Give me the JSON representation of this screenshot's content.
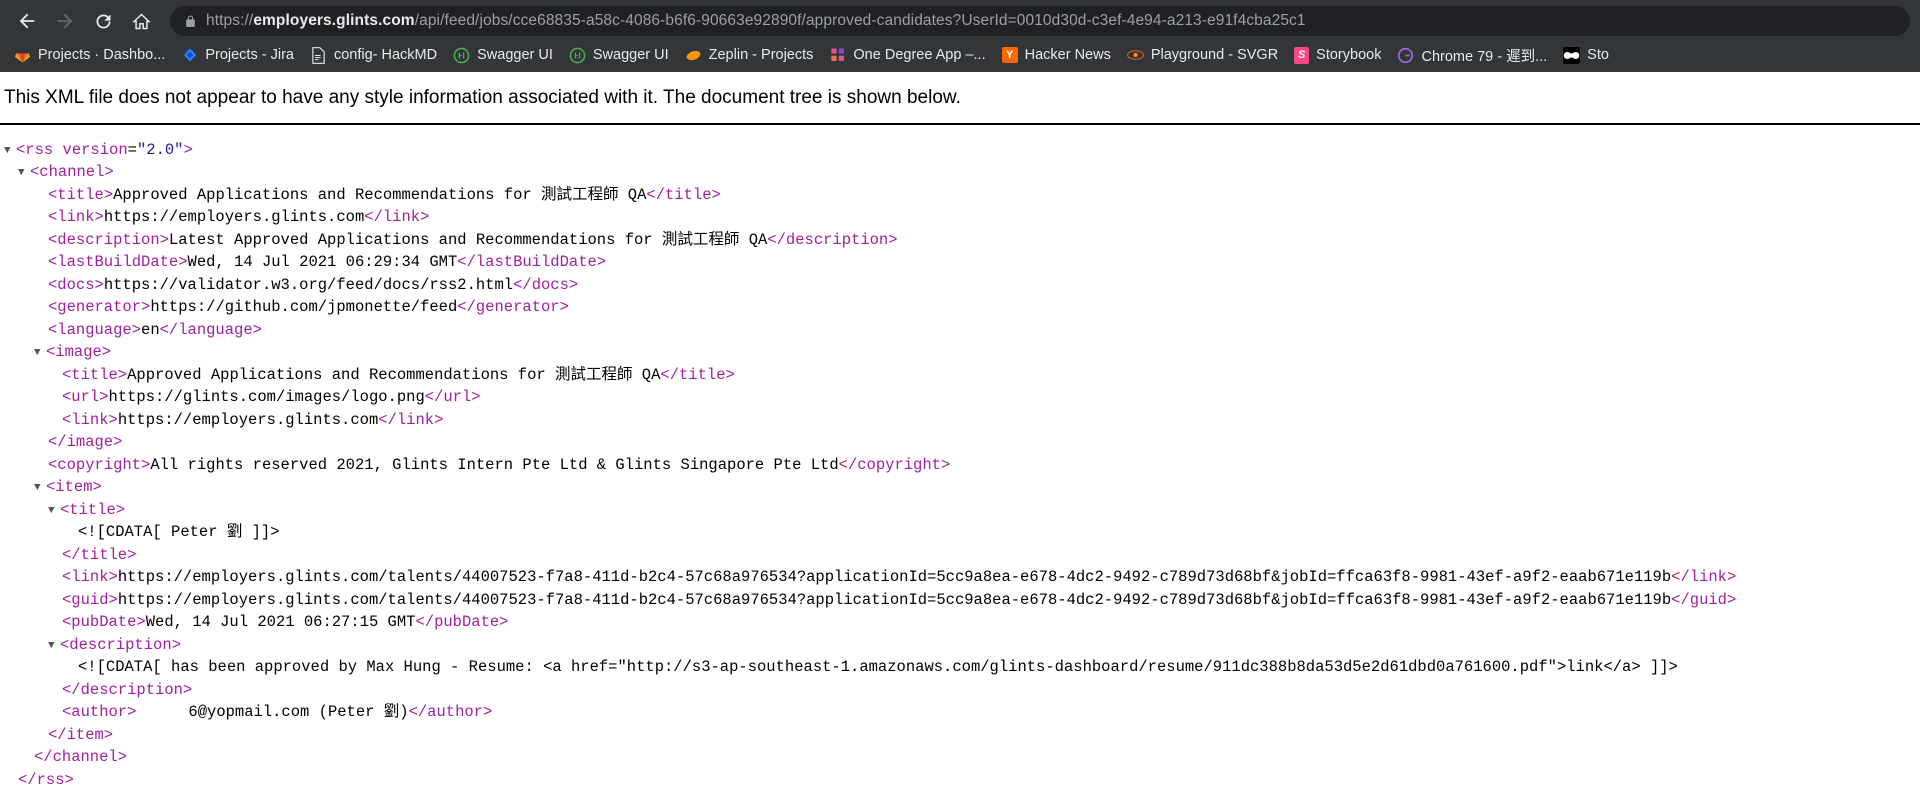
{
  "browser": {
    "nav": {
      "back_label": "Back",
      "forward_label": "Forward",
      "reload_label": "Reload",
      "home_label": "Home"
    },
    "omnibox": {
      "lock_icon": "lock-icon",
      "scheme": "https://",
      "host": "employers.glints.com",
      "path": "/api/feed/jobs/cce68835-a58c-4086-b6f6-90663e92890f/approved-candidates?UserId=0010d30d-c3ef-4e94-a213-e91f4cba25c1",
      "full_url": "https://employers.glints.com/api/feed/jobs/cce68835-a58c-4086-b6f6-90663e92890f/approved-candidates?UserId=0010d30d-c3ef-4e94-a213-e91f4cba25c1"
    },
    "bookmarks": [
      {
        "label": "Projects · Dashbo...",
        "icon": "gitlab-icon",
        "icon_glyph": "\u0000",
        "bg": "transparent",
        "fg": "#FC6D26"
      },
      {
        "label": "Projects - Jira",
        "icon": "jira-icon",
        "icon_glyph": "\u0000",
        "bg": "transparent",
        "fg": "#2684FF"
      },
      {
        "label": "config- HackMD",
        "icon": "document-icon",
        "icon_glyph": "\u0000",
        "bg": "transparent",
        "fg": "#ffffff"
      },
      {
        "label": "Swagger UI",
        "icon": "swagger-icon",
        "icon_glyph": "\u0000",
        "bg": "transparent",
        "fg": "#4CAF50"
      },
      {
        "label": "Swagger UI",
        "icon": "swagger-icon",
        "icon_glyph": "\u0000",
        "bg": "transparent",
        "fg": "#4CAF50"
      },
      {
        "label": "Zeplin - Projects",
        "icon": "zeplin-icon",
        "icon_glyph": "\u0000",
        "bg": "transparent",
        "fg": "#FF9800"
      },
      {
        "label": "One Degree App –...",
        "icon": "grid-icon",
        "icon_glyph": "\u0000",
        "bg": "transparent",
        "fg": "#E2548A"
      },
      {
        "label": "Hacker News",
        "icon": "hackernews-icon",
        "icon_glyph": "Y",
        "bg": "#FF6600",
        "fg": "#ffffff"
      },
      {
        "label": "Playground - SVGR",
        "icon": "svgr-icon",
        "icon_glyph": "\u0000",
        "bg": "transparent",
        "fg": "#FF5722"
      },
      {
        "label": "Storybook",
        "icon": "storybook-icon",
        "icon_glyph": "S",
        "bg": "#FF4785",
        "fg": "#ffffff"
      },
      {
        "label": "Chrome 79 - 遲到...",
        "icon": "grammarly-icon",
        "icon_glyph": "G",
        "bg": "transparent",
        "fg": "#9C6ADE"
      },
      {
        "label": "Sto",
        "icon": "binoculars-icon",
        "icon_glyph": "\u0000",
        "bg": "#000000",
        "fg": "#ffffff"
      }
    ]
  },
  "page": {
    "notice": "This XML file does not appear to have any style information associated with it. The document tree is shown below.",
    "xml": {
      "rss_open": "<rss",
      "rss_attr_name": "version",
      "rss_attr_eq": "=",
      "rss_attr_value": "\"2.0\"",
      "rss_close_bracket": ">",
      "channel_open": "<channel>",
      "channel_close": "</channel>",
      "rss_close": "</rss>",
      "item_open": "<item>",
      "item_close": "</item>",
      "image_open": "<image>",
      "image_close": "</image>",
      "title_open_tag": "<title>",
      "title_close_tag": "</title>",
      "description_open_tag": "<description>",
      "description_close_tag": "</description>",
      "channel_fields": [
        {
          "open": "<title>",
          "value": "Approved Applications and Recommendations for 測試工程師 QA",
          "close": "</title>"
        },
        {
          "open": "<link>",
          "value": "https://employers.glints.com",
          "close": "</link>"
        },
        {
          "open": "<description>",
          "value": "Latest Approved Applications and Recommendations for 測試工程師 QA",
          "close": "</description>"
        },
        {
          "open": "<lastBuildDate>",
          "value": "Wed, 14 Jul 2021 06:29:34 GMT",
          "close": "</lastBuildDate>"
        },
        {
          "open": "<docs>",
          "value": "https://validator.w3.org/feed/docs/rss2.html",
          "close": "</docs>"
        },
        {
          "open": "<generator>",
          "value": "https://github.com/jpmonette/feed",
          "close": "</generator>"
        },
        {
          "open": "<language>",
          "value": "en",
          "close": "</language>"
        }
      ],
      "image_fields": [
        {
          "open": "<title>",
          "value": "Approved Applications and Recommendations for 測試工程師 QA",
          "close": "</title>"
        },
        {
          "open": "<url>",
          "value": "https://glints.com/images/logo.png",
          "close": "</url>"
        },
        {
          "open": "<link>",
          "value": "https://employers.glints.com",
          "close": "</link>"
        }
      ],
      "copyright": {
        "open": "<copyright>",
        "value": "All rights reserved 2021, Glints Intern Pte Ltd & Glints Singapore Pte Ltd",
        "close": "</copyright>"
      },
      "item_title_cdata": "<![CDATA[ Peter 劉 ]]>",
      "item_fields": [
        {
          "open": "<link>",
          "value": "https://employers.glints.com/talents/44007523-f7a8-411d-b2c4-57c68a976534?applicationId=5cc9a8ea-e678-4dc2-9492-c789d73d68bf&jobId=ffca63f8-9981-43ef-a9f2-eaab671e119b",
          "close": "</link>"
        },
        {
          "open": "<guid>",
          "value": "https://employers.glints.com/talents/44007523-f7a8-411d-b2c4-57c68a976534?applicationId=5cc9a8ea-e678-4dc2-9492-c789d73d68bf&jobId=ffca63f8-9981-43ef-a9f2-eaab671e119b",
          "close": "</guid>"
        },
        {
          "open": "<pubDate>",
          "value": "Wed, 14 Jul 2021 06:27:15 GMT",
          "close": "</pubDate>"
        }
      ],
      "item_description_cdata": "<![CDATA[ has been approved by Max Hung - Resume: <a href=\"http://s3-ap-southeast-1.amazonaws.com/glints-dashboard/resume/911dc388b8da53d5e2d61dbd0a761600.pdf\">link</a> ]]>",
      "author": {
        "open": "<author>",
        "value_suffix": "6@yopmail.com (Peter 劉)",
        "close": "</author>"
      }
    }
  }
}
